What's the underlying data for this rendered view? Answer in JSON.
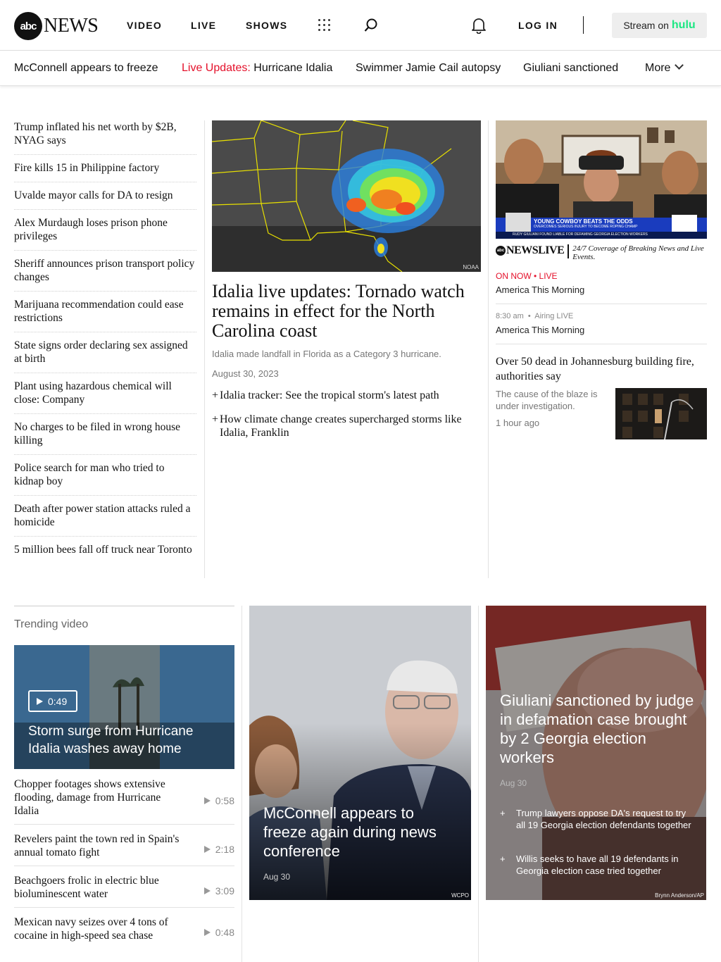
{
  "header": {
    "logo_circle": "abc",
    "logo_text": "NEWS",
    "nav": [
      "VIDEO",
      "LIVE",
      "SHOWS"
    ],
    "login": "LOG IN",
    "stream_prefix": "Stream on",
    "stream_brand": "hulu"
  },
  "trending_bar": {
    "items": [
      {
        "text": "McConnell appears to freeze"
      },
      {
        "prefix": "Live Updates:",
        "text": "Hurricane Idalia"
      },
      {
        "text": "Swimmer Jamie Cail autopsy"
      },
      {
        "text": "Giuliani sanctioned"
      }
    ],
    "more": "More"
  },
  "headlines": [
    "Trump inflated his net worth by $2B, NYAG says",
    "Fire kills 15 in Philippine factory",
    "Uvalde mayor calls for DA to resign",
    "Alex Murdaugh loses prison phone privileges",
    "Sheriff announces prison transport policy changes",
    "Marijuana recommendation could ease restrictions",
    "State signs order declaring sex assigned at birth",
    "Plant using hazardous chemical will close: Company",
    "No charges to be filed in wrong house killing",
    "Police search for man who tried to kidnap boy",
    "Death after power station attacks ruled a homicide",
    "5 million bees fall off truck near Toronto"
  ],
  "lead": {
    "image_credit": "NOAA",
    "title": "Idalia live updates: Tornado watch remains in effect for the North Carolina coast",
    "subtitle": "Idalia made landfall in Florida as a Category 3 hurricane.",
    "date": "August 30, 2023",
    "links": [
      "Idalia tracker: See the tropical storm's latest path",
      "How climate change creates supercharged storms like Idalia, Franklin"
    ]
  },
  "live": {
    "lower_third_main": "YOUNG COWBOY BEATS THE ODDS",
    "lower_third_sub": "OVERCOMES SERIOUS INJURY TO BECOME ROPING CHAMP",
    "ticker": "RUDY GIULIANI FOUND LIABLE FOR DEFAMING GEORGIA ELECTION WORKERS",
    "brand_dot": "abc",
    "brand": "NEWSLIVE",
    "tagline": "24/7 Coverage of Breaking News and Live Events.",
    "on_now": "ON NOW • LIVE",
    "show_now": "America This Morning",
    "next_time": "8:30 am",
    "next_status": "Airing LIVE",
    "show_next": "America This Morning"
  },
  "johannesburg": {
    "title": "Over 50 dead in Johannesburg building fire, authorities say",
    "subtitle": "The cause of the blaze is under investigation.",
    "time": "1 hour ago"
  },
  "trending_video": {
    "heading": "Trending video",
    "hero": {
      "duration": "0:49",
      "title": "Storm surge from Hurricane Idalia washes away home"
    },
    "items": [
      {
        "title": "Chopper footages shows extensive flooding, damage from Hurricane Idalia",
        "duration": "0:58"
      },
      {
        "title": "Revelers paint the town red in Spain's annual tomato fight",
        "duration": "2:18"
      },
      {
        "title": "Beachgoers frolic in electric blue bioluminescent water",
        "duration": "3:09"
      },
      {
        "title": "Mexican navy seizes over 4 tons of cocaine in high-speed sea chase",
        "duration": "0:48"
      }
    ]
  },
  "mcconnell": {
    "title": "McConnell appears to freeze again during news conference",
    "date": "Aug 30",
    "credit": "WCPO"
  },
  "giuliani": {
    "title": "Giuliani sanctioned by judge in defamation case brought by 2 Georgia election workers",
    "date": "Aug 30",
    "links": [
      "Trump lawyers oppose DA's request to try all 19 Georgia election defendants together",
      "Willis seeks to have all 19 defendants in Georgia election case tried together"
    ],
    "credit": "Brynn Anderson/AP"
  }
}
